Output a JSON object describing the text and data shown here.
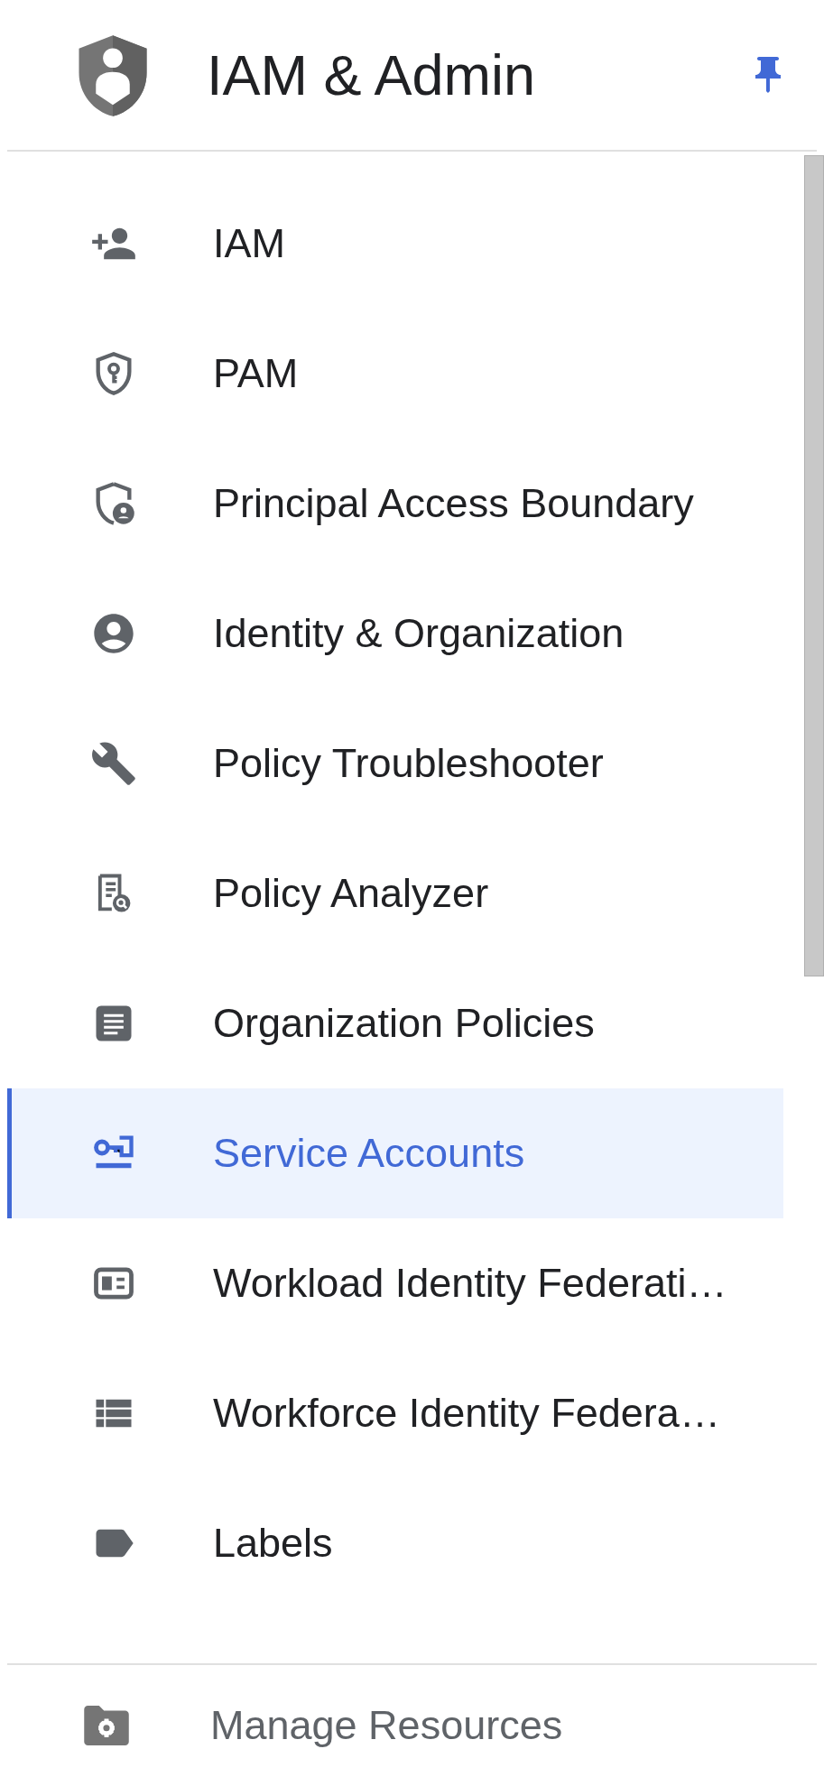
{
  "header": {
    "title": "IAM & Admin",
    "pinned": true
  },
  "nav_items": [
    {
      "label": "IAM",
      "selected": false
    },
    {
      "label": "PAM",
      "selected": false
    },
    {
      "label": "Principal Access Boundary",
      "selected": false
    },
    {
      "label": "Identity & Organization",
      "selected": false
    },
    {
      "label": "Policy Troubleshooter",
      "selected": false
    },
    {
      "label": "Policy Analyzer",
      "selected": false
    },
    {
      "label": "Organization Policies",
      "selected": false
    },
    {
      "label": "Service Accounts",
      "selected": true
    },
    {
      "label": "Workload Identity Federati…",
      "selected": false
    },
    {
      "label": "Workforce Identity Federa…",
      "selected": false
    },
    {
      "label": "Labels",
      "selected": false
    }
  ],
  "footer": {
    "label": "Manage Resources"
  }
}
